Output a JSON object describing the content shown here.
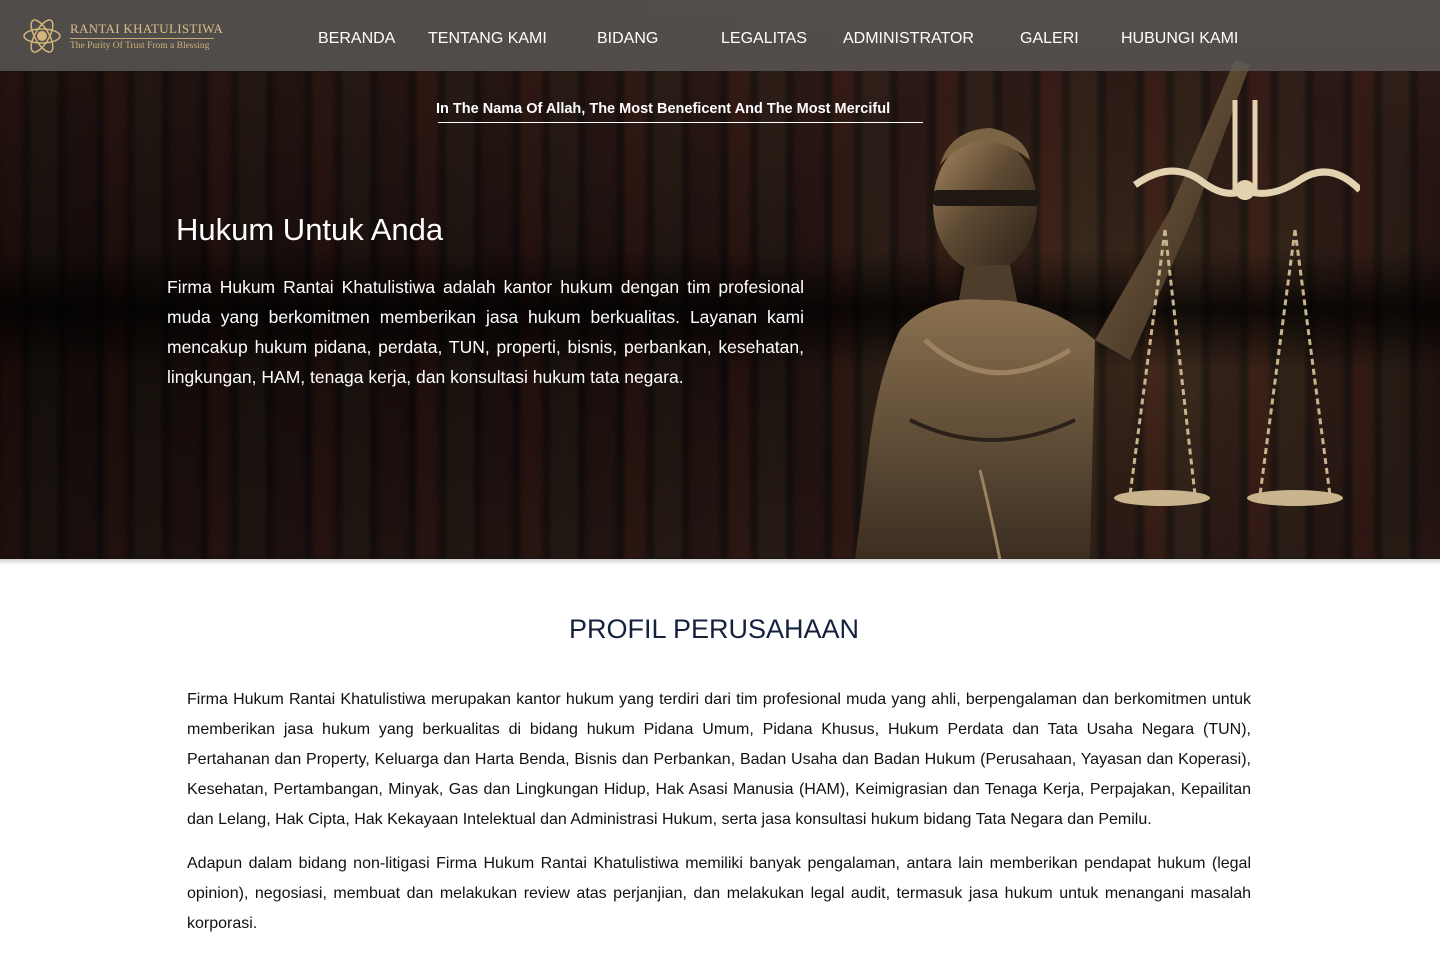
{
  "brand": {
    "name": "RANTAI KHATULISTIWA",
    "tagline": "The Purity Of Trust From a Blessing"
  },
  "nav": {
    "items": [
      {
        "label": "BERANDA"
      },
      {
        "label": "TENTANG KAMI"
      },
      {
        "label": "BIDANG"
      },
      {
        "label": "LEGALITAS"
      },
      {
        "label": "ADMINISTRATOR"
      },
      {
        "label": "GALERI"
      },
      {
        "label": "HUBUNGI KAMI"
      }
    ]
  },
  "hero": {
    "blessing": "In The Nama Of Allah, The Most Beneficent And The Most Merciful",
    "title": "Hukum Untuk Anda",
    "description": "Firma Hukum Rantai Khatulistiwa adalah kantor hukum dengan tim profesional muda yang berkomitmen memberikan jasa hukum berkualitas. Layanan kami mencakup hukum pidana, perdata, TUN, properti, bisnis, perbankan, kesehatan, lingkungan, HAM, tenaga kerja, dan konsultasi hukum tata negara."
  },
  "profile": {
    "title": "PROFIL PERUSAHAAN",
    "paragraph1": "Firma Hukum Rantai Khatulistiwa merupakan kantor hukum yang  terdiri dari tim profesional muda yang ahli, berpengalaman dan berkomitmen untuk memberikan jasa hukum yang berkualitas di bidang hukum Pidana Umum, Pidana Khusus, Hukum Perdata dan Tata Usaha Negara (TUN), Pertahanan dan Property, Keluarga dan Harta Benda, Bisnis dan Perbankan, Badan Usaha dan Badan Hukum (Perusahaan, Yayasan dan Koperasi), Kesehatan, Pertambangan, Minyak, Gas dan Lingkungan Hidup, Hak Asasi Manusia (HAM), Keimigrasian dan Tenaga Kerja, Perpajakan, Kepailitan dan Lelang, Hak Cipta, Hak Kekayaan Intelektual dan Administrasi Hukum, serta jasa konsultasi hukum bidang Tata Negara dan Pemilu.",
    "paragraph2": "Adapun dalam bidang non-litigasi Firma Hukum Rantai Khatulistiwa memiliki banyak pengalaman, antara lain memberikan pendapat hukum (legal opinion), negosiasi, membuat dan melakukan review atas perjanjian, dan melakukan legal audit, termasuk jasa hukum untuk menangani masalah korporasi."
  },
  "colors": {
    "heading": "#14213d",
    "brand_gold": "#d9c08a",
    "nav_bg": "#5f5c5a"
  },
  "icons": {
    "logo": "atom-emblem-icon",
    "hero_image": "lady-justice-scales"
  }
}
